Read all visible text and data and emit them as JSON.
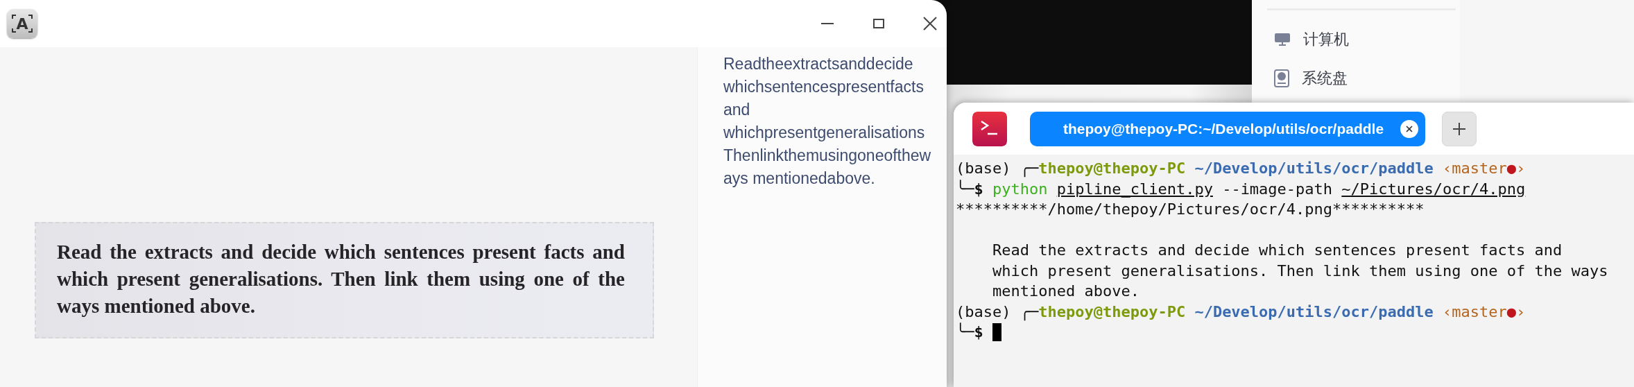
{
  "ocr_window": {
    "app_icon": "A",
    "source_image": {
      "text": "Read the extracts and decide which sentences present facts and which present generalisations. Then link them using one of the ways mentioned above."
    },
    "result_text": "Readtheextractsanddecide whichsentencespresentfacts and whichpresentgeneralisationsThenlinkthemusingoneoftheways mentionedabove."
  },
  "file_manager": {
    "items": [
      {
        "label": "计算机",
        "kind": "computer"
      },
      {
        "label": "系统盘",
        "kind": "disk"
      }
    ]
  },
  "terminal": {
    "tabs": [
      {
        "title": "thepoy@thepoy-PC:~/Develop/utils/ocr/paddle",
        "selected": true
      }
    ],
    "lines": [
      {
        "kind": "text",
        "segments": [
          {
            "text": "(base) ╭─",
            "kind": "plain"
          },
          {
            "text": "thepoy@thepoy-PC ",
            "kind": "user"
          },
          {
            "text": "~/Develop/utils/ocr/paddle ",
            "kind": "path"
          },
          {
            "text": "‹master",
            "kind": "branch"
          },
          {
            "text": "●",
            "kind": "dirty"
          },
          {
            "text": "›",
            "kind": "branch"
          }
        ]
      },
      {
        "kind": "text",
        "segments": [
          {
            "text": "╰─",
            "kind": "plain"
          },
          {
            "text": "$ ",
            "kind": "sigil"
          },
          {
            "text": "python ",
            "kind": "command"
          },
          {
            "text": "pipline_client.py",
            "kind": "file"
          },
          {
            "text": " --image-path ",
            "kind": "plain"
          },
          {
            "text": "~/Pictures/ocr/4.png",
            "kind": "file"
          }
        ]
      },
      {
        "kind": "text",
        "segments": [
          {
            "text": "**********/home/thepoy/Pictures/ocr/4.png**********",
            "kind": "plain"
          }
        ]
      },
      {
        "kind": "blank"
      },
      {
        "kind": "text",
        "segments": [
          {
            "text": "    Read the extracts and decide which sentences present facts and",
            "kind": "plain"
          }
        ]
      },
      {
        "kind": "text",
        "segments": [
          {
            "text": "    which present generalisations. Then link them using one of the ways",
            "kind": "plain"
          }
        ]
      },
      {
        "kind": "text",
        "segments": [
          {
            "text": "    mentioned above.",
            "kind": "plain"
          }
        ]
      },
      {
        "kind": "text",
        "segments": [
          {
            "text": "(base) ╭─",
            "kind": "plain"
          },
          {
            "text": "thepoy@thepoy-PC ",
            "kind": "user"
          },
          {
            "text": "~/Develop/utils/ocr/paddle ",
            "kind": "path"
          },
          {
            "text": "‹master",
            "kind": "branch"
          },
          {
            "text": "●",
            "kind": "dirty"
          },
          {
            "text": "›",
            "kind": "branch"
          }
        ]
      },
      {
        "kind": "text",
        "cursor": true,
        "segments": [
          {
            "text": "╰─",
            "kind": "plain"
          },
          {
            "text": "$",
            "kind": "sigil"
          }
        ]
      }
    ]
  }
}
